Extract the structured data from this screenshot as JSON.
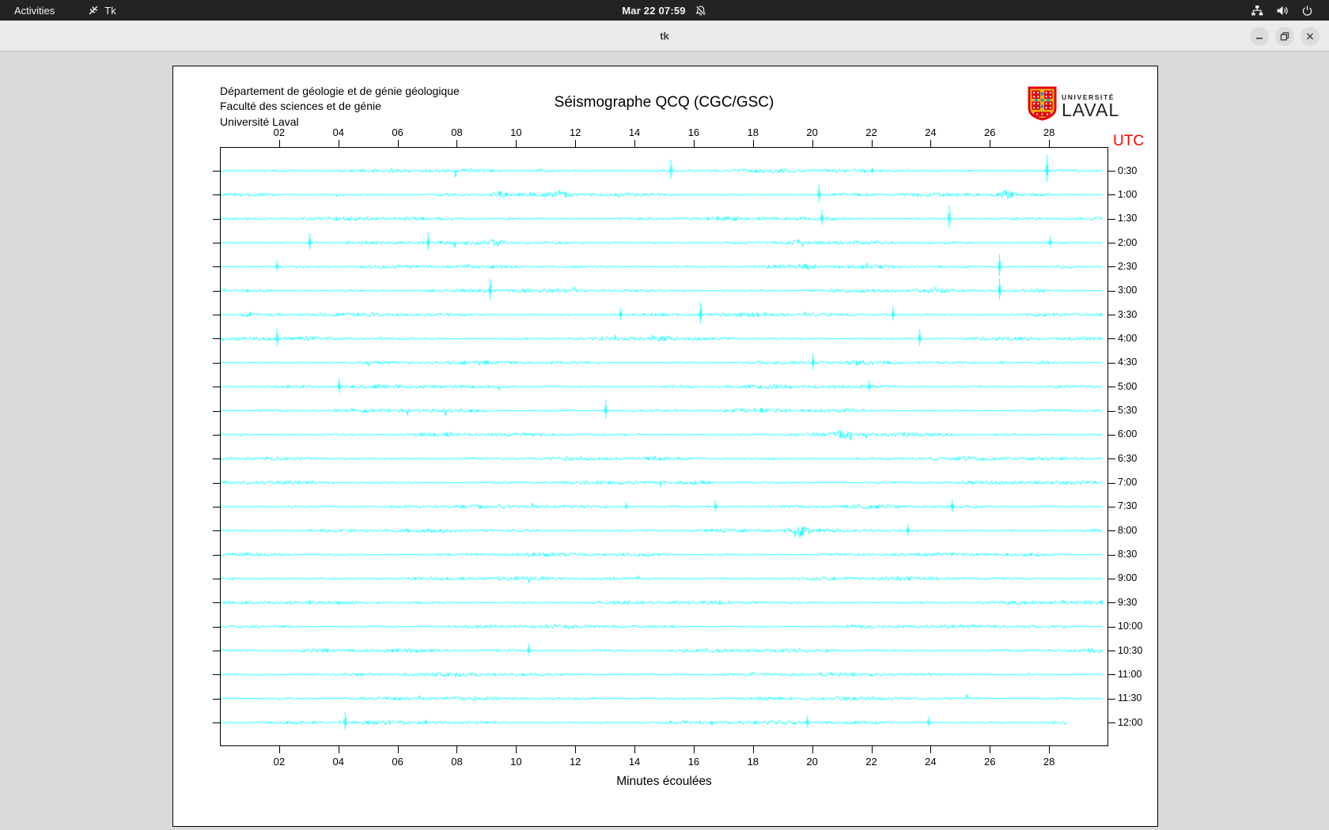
{
  "topbar": {
    "activities": "Activities",
    "app_name": "Tk",
    "clock": "Mar 22  07:59"
  },
  "titlebar": {
    "title": "tk"
  },
  "figure": {
    "header_lines": [
      "Département de géologie et de génie géologique",
      "Faculté des sciences et de génie",
      "Université Laval"
    ],
    "logo": {
      "line1": "UNIVERSITÉ",
      "line2": "LAVAL"
    }
  },
  "chart_data": {
    "type": "line",
    "title": "Séismographe QCQ (CGC/GSC)",
    "xlabel": "Minutes écoulées",
    "y_axis_label": "UTC",
    "x_range": [
      0,
      30
    ],
    "x_ticks": [
      "02",
      "04",
      "06",
      "08",
      "10",
      "12",
      "14",
      "16",
      "18",
      "20",
      "22",
      "24",
      "26",
      "28"
    ],
    "trace_color": "#00ffff",
    "grid": false,
    "legend": "none",
    "row_spacing_px": 30.35,
    "rows": [
      {
        "utc": "0:30",
        "end_min": 29.8,
        "events": [
          [
            10.8,
            5,
            "b"
          ],
          [
            15.2,
            14,
            "s"
          ],
          [
            22.0,
            4,
            "s"
          ],
          [
            27.9,
            20,
            "s"
          ]
        ]
      },
      {
        "utc": "1:00",
        "end_min": 29.8,
        "events": [
          [
            9.4,
            6,
            "b"
          ],
          [
            11.5,
            4,
            "b"
          ],
          [
            20.2,
            13,
            "s"
          ],
          [
            26.5,
            6,
            "b"
          ]
        ]
      },
      {
        "utc": "1:30",
        "end_min": 29.8,
        "events": [
          [
            9.6,
            4,
            "b"
          ],
          [
            20.3,
            11,
            "s"
          ],
          [
            24.6,
            17,
            "s"
          ]
        ]
      },
      {
        "utc": "2:00",
        "end_min": 29.8,
        "events": [
          [
            3.0,
            12,
            "s"
          ],
          [
            7.0,
            13,
            "s"
          ],
          [
            9.3,
            5,
            "b"
          ],
          [
            19.6,
            5,
            "b"
          ],
          [
            28.0,
            8,
            "s"
          ]
        ]
      },
      {
        "utc": "2:30",
        "end_min": 29.8,
        "events": [
          [
            1.9,
            8,
            "s"
          ],
          [
            19.8,
            4,
            "b"
          ],
          [
            26.3,
            16,
            "s"
          ],
          [
            28.5,
            5,
            "b"
          ]
        ]
      },
      {
        "utc": "3:00",
        "end_min": 29.8,
        "events": [
          [
            9.1,
            15,
            "s"
          ],
          [
            26.3,
            16,
            "s"
          ],
          [
            27.7,
            5,
            "b"
          ]
        ]
      },
      {
        "utc": "3:30",
        "end_min": 29.8,
        "events": [
          [
            0.9,
            4,
            "b"
          ],
          [
            13.5,
            9,
            "s"
          ],
          [
            16.2,
            15,
            "s"
          ],
          [
            22.7,
            10,
            "s"
          ]
        ]
      },
      {
        "utc": "4:00",
        "end_min": 29.8,
        "events": [
          [
            1.9,
            13,
            "s"
          ],
          [
            14.9,
            4,
            "b"
          ],
          [
            23.6,
            12,
            "s"
          ]
        ]
      },
      {
        "utc": "4:30",
        "end_min": 29.8,
        "events": [
          [
            20.0,
            12,
            "s"
          ],
          [
            26.4,
            6,
            "b"
          ],
          [
            27.8,
            6,
            "b"
          ]
        ]
      },
      {
        "utc": "5:00",
        "end_min": 29.8,
        "events": [
          [
            4.0,
            11,
            "s"
          ],
          [
            21.9,
            8,
            "s"
          ]
        ]
      },
      {
        "utc": "5:30",
        "end_min": 29.8,
        "events": [
          [
            13.0,
            14,
            "s"
          ]
        ]
      },
      {
        "utc": "6:00",
        "end_min": 29.8,
        "events": [
          [
            21.0,
            5,
            "b"
          ]
        ]
      },
      {
        "utc": "6:30",
        "end_min": 29.8,
        "events": []
      },
      {
        "utc": "7:00",
        "end_min": 29.8,
        "events": []
      },
      {
        "utc": "7:30",
        "end_min": 29.8,
        "events": [
          [
            13.7,
            5,
            "s"
          ],
          [
            16.7,
            8,
            "s"
          ],
          [
            24.7,
            9,
            "s"
          ]
        ]
      },
      {
        "utc": "8:00",
        "end_min": 29.8,
        "events": [
          [
            19.5,
            8,
            "b"
          ],
          [
            23.2,
            8,
            "s"
          ]
        ]
      },
      {
        "utc": "8:30",
        "end_min": 29.8,
        "events": []
      },
      {
        "utc": "9:00",
        "end_min": 29.8,
        "events": []
      },
      {
        "utc": "9:30",
        "end_min": 29.8,
        "events": []
      },
      {
        "utc": "10:00",
        "end_min": 29.8,
        "events": []
      },
      {
        "utc": "10:30",
        "end_min": 29.8,
        "events": [
          [
            10.4,
            9,
            "s"
          ]
        ]
      },
      {
        "utc": "11:00",
        "end_min": 29.8,
        "events": []
      },
      {
        "utc": "11:30",
        "end_min": 29.8,
        "events": []
      },
      {
        "utc": "12:00",
        "end_min": 28.6,
        "events": [
          [
            4.2,
            13,
            "s"
          ],
          [
            19.8,
            9,
            "s"
          ],
          [
            23.9,
            7,
            "s"
          ]
        ]
      }
    ]
  }
}
